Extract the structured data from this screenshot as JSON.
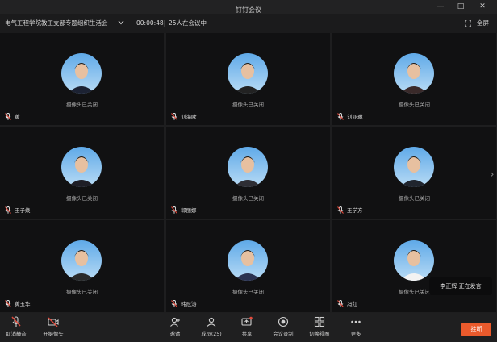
{
  "window": {
    "title": "钉钉会议",
    "min": "—",
    "max": "□",
    "close": "✕"
  },
  "info": {
    "meeting_title": "电气工程学院教工支部专题组织生活会",
    "timer": "00:00:48",
    "count": "25人在会议中",
    "fullscreen": "全屏"
  },
  "camera_off": "摄像头已关闭",
  "participants": [
    {
      "name": "黄"
    },
    {
      "name": "刘海欧"
    },
    {
      "name": "刘亚琳"
    },
    {
      "name": "王子焕"
    },
    {
      "name": "郭丽娜"
    },
    {
      "name": "王学方"
    },
    {
      "name": "黄玉华"
    },
    {
      "name": "韩冠涛"
    },
    {
      "name": "冯红"
    }
  ],
  "speaker_toast": "李正辉  正在发言",
  "toolbar": {
    "mute": "取消静音",
    "camera": "开摄像头",
    "invite": "邀请",
    "members": "成员(25)",
    "share": "共享",
    "record": "会议录制",
    "switch_view": "切换视图",
    "more": "更多",
    "leave": "挂断"
  },
  "colors": {
    "accent": "#ea5a2c",
    "mic_muted": "#e14a3c",
    "tile_bg": "#111112"
  }
}
